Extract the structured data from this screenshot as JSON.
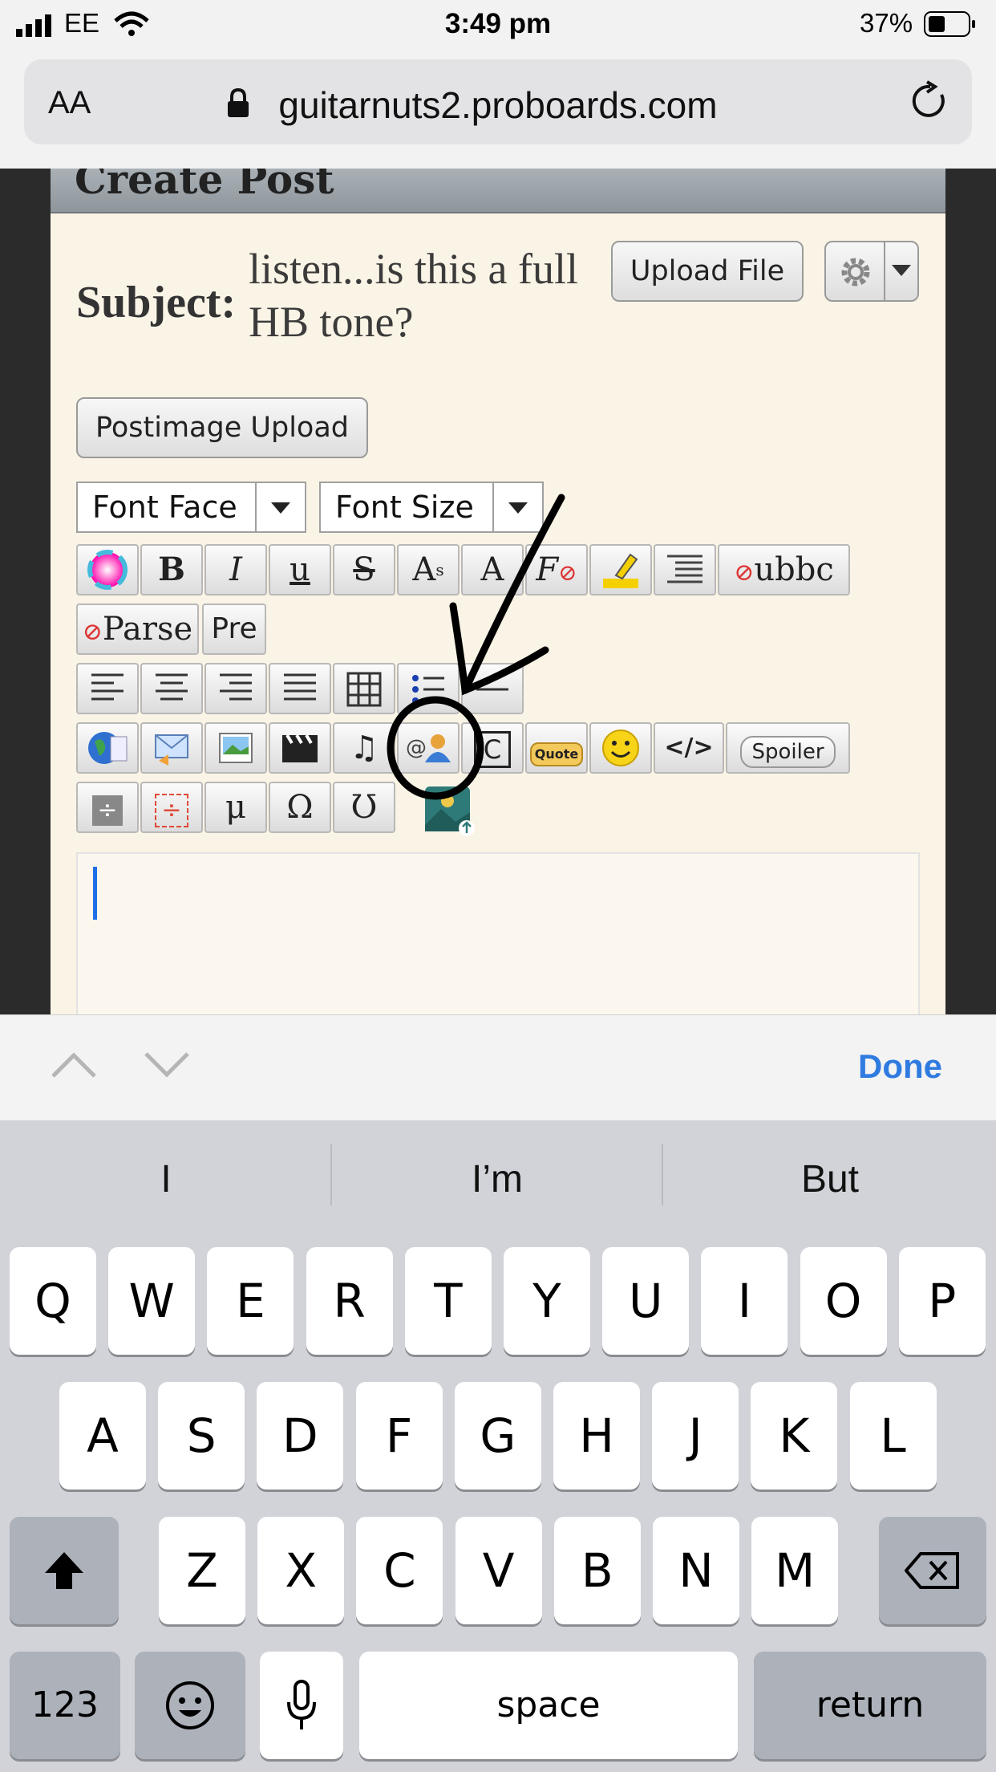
{
  "status_bar": {
    "carrier": "EE",
    "time": "3:49 pm",
    "battery": "37%"
  },
  "browser": {
    "text_size_label": "AA",
    "url": "guitarnuts2.proboards.com"
  },
  "page": {
    "header_title": "Create Post",
    "subject_label": "Subject:",
    "subject_value": "listen...is this a full HB tone?",
    "upload_file_label": "Upload File",
    "postimage_label": "Postimage Upload",
    "font_face_label": "Font Face",
    "font_size_label": "Font Size",
    "toolbar": {
      "ubbc_label": "ubbc",
      "parse_label": "Parse",
      "pre_label": "Pre",
      "quote_label": "Quote",
      "spoiler_label": "Spoiler",
      "code_label": "</>",
      "mu_label": "μ",
      "omega_label": "Ω",
      "breve_label": "Ʊ"
    }
  },
  "accessory": {
    "done_label": "Done"
  },
  "keyboard": {
    "suggestions": [
      "I",
      "I’m",
      "But"
    ],
    "row1": [
      "Q",
      "W",
      "E",
      "R",
      "T",
      "Y",
      "U",
      "I",
      "O",
      "P"
    ],
    "row2": [
      "A",
      "S",
      "D",
      "F",
      "G",
      "H",
      "J",
      "K",
      "L"
    ],
    "row3": [
      "Z",
      "X",
      "C",
      "V",
      "B",
      "N",
      "M"
    ],
    "numbers_label": "123",
    "space_label": "space",
    "return_label": "return"
  },
  "colors": {
    "accent": "#2f7be0",
    "page_bg": "#faf4e6",
    "keyboard_bg": "#d1d3d9"
  }
}
